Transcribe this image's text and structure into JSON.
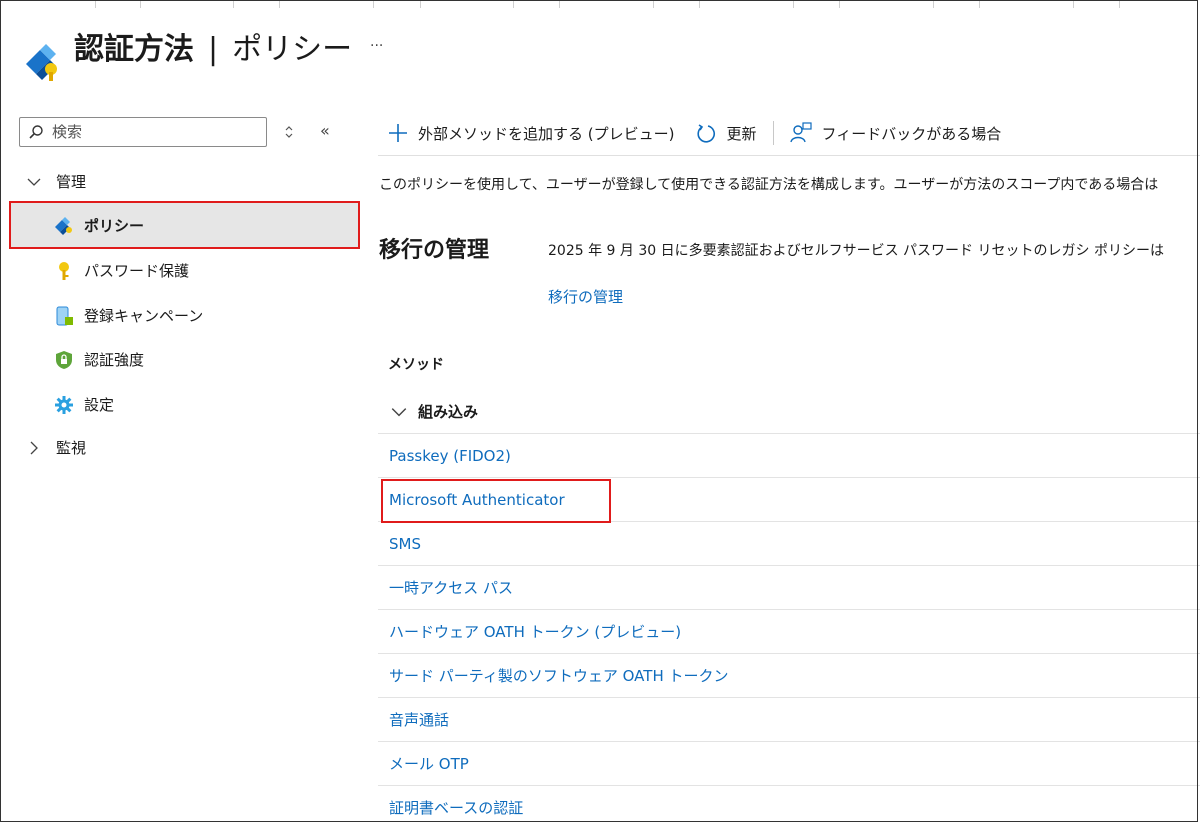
{
  "header": {
    "title": "認証方法",
    "separator": "|",
    "subtitle": "ポリシー",
    "more": "···"
  },
  "sidebar": {
    "search_placeholder": "検索",
    "groups": [
      {
        "label": "管理",
        "expanded": true
      },
      {
        "label": "監視",
        "expanded": false
      }
    ],
    "items": [
      {
        "label": "ポリシー",
        "icon": "policy-diamond-icon",
        "selected": true
      },
      {
        "label": "パスワード保護",
        "icon": "key-icon"
      },
      {
        "label": "登録キャンペーン",
        "icon": "phone-campaign-icon"
      },
      {
        "label": "認証強度",
        "icon": "shield-lock-icon"
      },
      {
        "label": "設定",
        "icon": "gear-icon"
      }
    ]
  },
  "toolbar": {
    "add_label": "外部メソッドを追加する (プレビュー)",
    "refresh_label": "更新",
    "feedback_label": "フィードバックがある場合"
  },
  "description": "このポリシーを使用して、ユーザーが登録して使用できる認証方法を構成します。ユーザーが方法のスコープ内である場合は",
  "migration": {
    "title": "移行の管理",
    "text": "2025 年 9 月 30 日に多要素認証およびセルフサービス パスワード リセットのレガシ ポリシーは",
    "link": "移行の管理"
  },
  "table": {
    "column_header": "メソッド",
    "group_label": "組み込み",
    "methods": [
      "Passkey (FIDO2)",
      "Microsoft Authenticator",
      "SMS",
      "一時アクセス パス",
      "ハードウェア OATH トークン (プレビュー)",
      "サード パーティ製のソフトウェア OATH トークン",
      "音声通話",
      "メール OTP",
      "証明書ベースの認証"
    ]
  },
  "colors": {
    "link": "#0f6cbd",
    "highlight_border": "#e01b1b",
    "selected_bg": "#e6e6e6"
  }
}
